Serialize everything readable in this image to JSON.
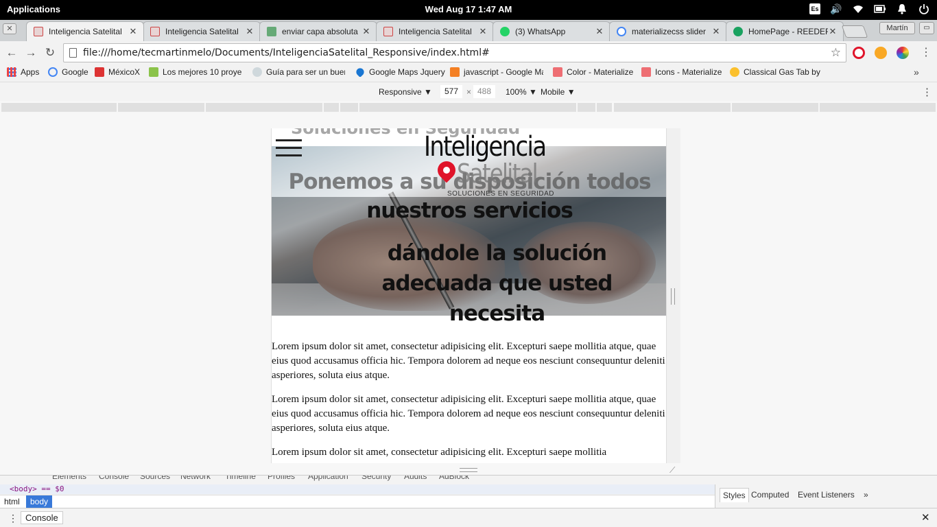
{
  "system": {
    "activities": "Applications",
    "clock": "Wed Aug 17   1:47 AM",
    "lang": "Es"
  },
  "tabs": [
    {
      "title": "Inteligencia Satelital",
      "active": true,
      "color": "#c44"
    },
    {
      "title": "Inteligencia Satelital",
      "active": false,
      "color": "#c44"
    },
    {
      "title": "enviar capa absoluta",
      "active": false,
      "color": "#6a7"
    },
    {
      "title": "Inteligencia Satelital",
      "active": false,
      "color": "#c44"
    },
    {
      "title": "(3) WhatsApp",
      "active": false,
      "color": "#25d366"
    },
    {
      "title": "materializecss slider",
      "active": false,
      "color": "#4285f4"
    },
    {
      "title": "HomePage - REEDER",
      "active": false,
      "color": "#1aa260"
    }
  ],
  "profile": "Martín",
  "toolbar": {
    "url": "file:///home/tecmartinmelo/Documents/InteligenciaSatelital_Responsive/index.html#"
  },
  "bookmarks": [
    {
      "label": "Apps",
      "color": "#e44"
    },
    {
      "label": "Google",
      "color": "#4285f4"
    },
    {
      "label": "MéxicoX",
      "color": "#d33"
    },
    {
      "label": "Los mejores 10 proye",
      "color": "#8bc34a"
    },
    {
      "label": "Guía para ser un buer",
      "color": "#90a4ae"
    },
    {
      "label": "Google Maps Jquery",
      "color": "#1976d2"
    },
    {
      "label": "javascript - Google Ma",
      "color": "#f48024"
    },
    {
      "label": "Color - Materialize",
      "color": "#ee6e73"
    },
    {
      "label": "Icons - Materialize",
      "color": "#ee6e73"
    },
    {
      "label": "Classical Gas Tab by M",
      "color": "#fbc02d"
    }
  ],
  "device_toolbar": {
    "mode": "Responsive",
    "width": "577",
    "times": "×",
    "height": "488",
    "zoom": "100%",
    "type": "Mobile"
  },
  "site": {
    "tagline_top": "Soluciones en Seguridad",
    "logo_line1": "Inteligencia",
    "logo_line2": "Satelital",
    "logo_line3": "SOLUCIONES EN SEGURIDAD",
    "hero_line1": "Ponemos a su disposición todos",
    "hero_line2": "nuestros servicios",
    "hero_line3": "dándole la solución adecuada que usted necesita",
    "paragraphs": [
      "Lorem ipsum dolor sit amet, consectetur adipisicing elit. Excepturi saepe mollitia atque, quae eius quod accusamus officia hic. Tempora dolorem ad neque eos nesciunt consequuntur deleniti asperiores, soluta eius atque.",
      "Lorem ipsum dolor sit amet, consectetur adipisicing elit. Excepturi saepe mollitia atque, quae eius quod accusamus officia hic. Tempora dolorem ad neque eos nesciunt consequuntur deleniti asperiores, soluta eius atque.",
      "Lorem ipsum dolor sit amet, consectetur adipisicing elit. Excepturi saepe mollitia"
    ]
  },
  "devtools": {
    "tabs": [
      "Elements",
      "Console",
      "Sources",
      "Network",
      "Timeline",
      "Profiles",
      "Application",
      "Security",
      "Audits",
      "AdBlock"
    ],
    "selected_node": "<body> == $0",
    "crumbs": [
      "html",
      "body"
    ],
    "styles_tabs": [
      "Styles",
      "Computed",
      "Event Listeners"
    ],
    "drawer_tab": "Console"
  }
}
